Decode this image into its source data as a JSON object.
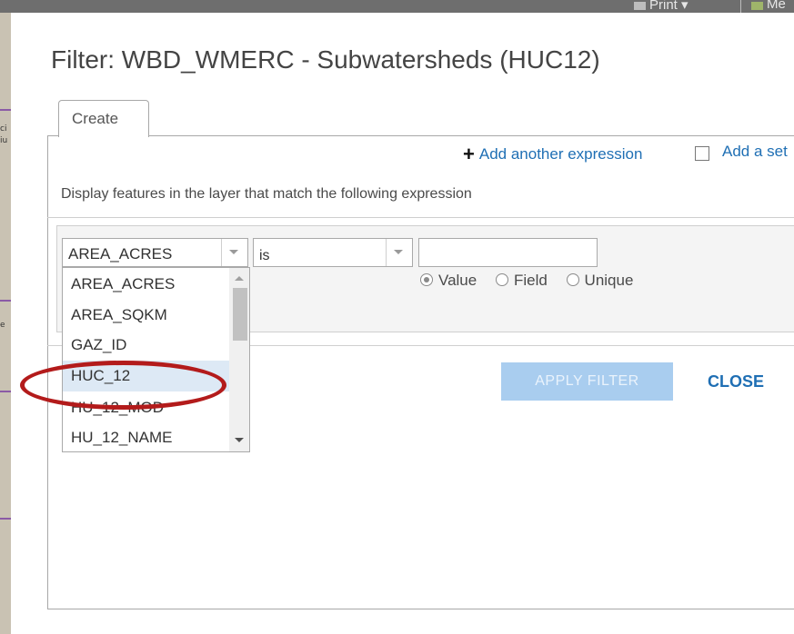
{
  "toolbar": {
    "print_label": "Print ▾",
    "measure_label": "Me"
  },
  "map_fragments": [
    "ci",
    "iu",
    "e"
  ],
  "dialog": {
    "title": "Filter: WBD_WMERC - Subwatersheds (HUC12)",
    "tab_create": "Create",
    "add_expression": "Add another expression",
    "add_set": "Add a set",
    "instruction": "Display features in the layer that match the following expression",
    "field_value": "AREA_ACRES",
    "operator_value": "is",
    "value_input": "",
    "radio_options": [
      {
        "label": "Value",
        "checked": true
      },
      {
        "label": "Field",
        "checked": false
      },
      {
        "label": "Unique",
        "checked": false
      }
    ],
    "field_options": [
      "AREA_ACRES",
      "AREA_SQKM",
      "GAZ_ID",
      "HUC_12",
      "HU_12_MOD",
      "HU_12_NAME"
    ],
    "highlighted_option": "HUC_12",
    "apply_button": "APPLY FILTER",
    "close_button": "CLOSE"
  },
  "colors": {
    "link_blue": "#1f6fb4",
    "apply_disabled": "#a9cdef",
    "highlight_red": "#b31b1b",
    "selected_row": "#dde9f5"
  }
}
